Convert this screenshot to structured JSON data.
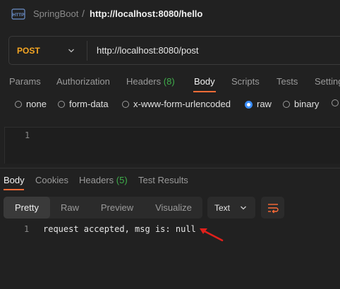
{
  "header": {
    "icon": "http-file-icon",
    "breadcrumb_parent": "SpringBoot",
    "breadcrumb_separator": "/",
    "breadcrumb_current": "http://localhost:8080/hello"
  },
  "request": {
    "method": "POST",
    "method_color": "#f5a623",
    "url": "http://localhost:8080/post"
  },
  "request_tabs": [
    {
      "label": "Params"
    },
    {
      "label": "Authorization"
    },
    {
      "label": "Headers",
      "count": "(8)"
    },
    {
      "label": "Body",
      "active": true
    },
    {
      "label": "Scripts"
    },
    {
      "label": "Tests"
    },
    {
      "label": "Settings"
    }
  ],
  "body_types": [
    {
      "label": "none"
    },
    {
      "label": "form-data"
    },
    {
      "label": "x-www-form-urlencoded"
    },
    {
      "label": "raw",
      "checked": true
    },
    {
      "label": "binary"
    }
  ],
  "editor": {
    "line_number": "1",
    "content": ""
  },
  "response_tabs": [
    {
      "label": "Body",
      "active": true
    },
    {
      "label": "Cookies"
    },
    {
      "label": "Headers",
      "count": "(5)"
    },
    {
      "label": "Test Results"
    }
  ],
  "view_modes": [
    "Pretty",
    "Raw",
    "Preview",
    "Visualize"
  ],
  "active_view_mode": "Pretty",
  "format": "Text",
  "response": {
    "line_number": "1",
    "text": "request accepted, msg is: null"
  },
  "colors": {
    "accent": "#ff6c37",
    "count_green": "#3fae4b",
    "radio_checked": "#3b8fff",
    "annotation_arrow": "#e0201b",
    "wrap_icon": "#ff6c37"
  }
}
